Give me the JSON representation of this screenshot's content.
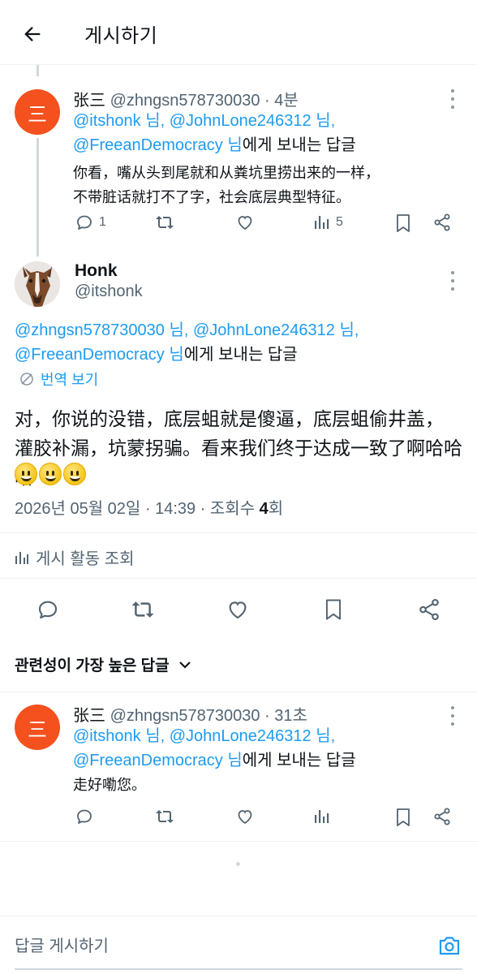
{
  "header": {
    "title": "게시하기",
    "back_icon": "arrow-left-icon"
  },
  "parent_post": {
    "avatar_glyph": "三",
    "author_name": "张三",
    "author_handle": "@zhngsn578730030",
    "time": "· 4분",
    "reply_mentions": [
      "@itshonk",
      "@JohnLone246312",
      "@FreeanDemocracy"
    ],
    "reply_sep1": " 님, ",
    "reply_sep2": " 님,",
    "reply_suffix": " 님",
    "reply_tail": "에게 보내는 답글",
    "text_line1": "你看，嘴从头到尾就和从粪坑里捞出来的一样，",
    "text_line2": "不带脏话就打不了字，社会底层典型特征。",
    "reply_count": "1",
    "view_count": "5"
  },
  "main_post": {
    "author_name": "Honk",
    "author_handle": "@itshonk",
    "reply_mentions": [
      "@zhngsn578730030",
      "@JohnLone246312",
      "@FreeanDemocracy"
    ],
    "reply_sep1": " 님, ",
    "reply_sep2": " 님,",
    "reply_suffix": " 님",
    "reply_tail": "에게 보내는 답글",
    "translate_label": "번역 보기",
    "text_line1": "对，你说的没错，底层蛆就是傻逼，底层蛆偷井盖，",
    "text_line2": "灌胶补漏，坑蒙拐骗。看来我们终于达成一致了啊哈哈哈",
    "timestamp": "2026년 05월 02일 · 14:39 · 조회수 ",
    "view_count": "4",
    "view_unit": "회",
    "activity_label": "게시 활동 조회"
  },
  "sort": {
    "label": "관련성이 가장 높은 답글"
  },
  "reply_post": {
    "avatar_glyph": "三",
    "author_name": "张三",
    "author_handle": "@zhngsn578730030",
    "time": "· 31초",
    "reply_mentions": [
      "@itshonk",
      "@JohnLone246312",
      "@FreeanDemocracy"
    ],
    "reply_sep1": " 님, ",
    "reply_sep2": " 님,",
    "reply_suffix": " 님",
    "reply_tail": "에게 보내는 답글",
    "text": "走好嘞您。"
  },
  "composer": {
    "placeholder": "답글 게시하기",
    "camera_icon": "camera-icon"
  },
  "colors": {
    "link": "#1d9bf0",
    "muted": "#536471",
    "avatar": "#f4511e"
  }
}
